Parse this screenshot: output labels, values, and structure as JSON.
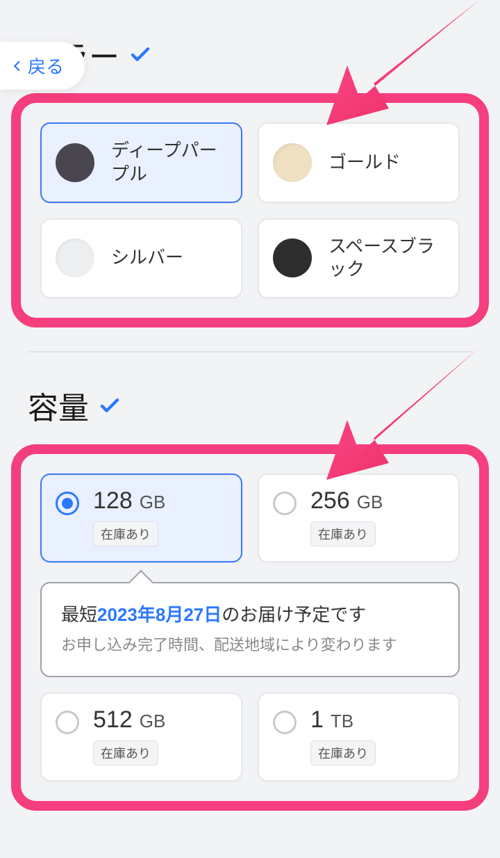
{
  "back": {
    "label": "戻る"
  },
  "colorSection": {
    "title": "カラー",
    "options": [
      {
        "label": "ディープパープル",
        "swatch": "#4a4650",
        "selected": true
      },
      {
        "label": "ゴールド",
        "swatch": "#eee0c1",
        "selected": false
      },
      {
        "label": "シルバー",
        "swatch": "#eceef0",
        "selected": false
      },
      {
        "label": "スペースブラック",
        "swatch": "#2d2d2d",
        "selected": false
      }
    ]
  },
  "capacitySection": {
    "title": "容量",
    "options": [
      {
        "num": "128",
        "unit": "GB",
        "stock": "在庫あり",
        "selected": true
      },
      {
        "num": "256",
        "unit": "GB",
        "stock": "在庫あり",
        "selected": false
      },
      {
        "num": "512",
        "unit": "GB",
        "stock": "在庫あり",
        "selected": false
      },
      {
        "num": "1",
        "unit": "TB",
        "stock": "在庫あり",
        "selected": false
      }
    ],
    "delivery": {
      "pre": "最短",
      "date": "2023年8月27日",
      "post": "のお届け予定です",
      "note": "お申し込み完了時間、配送地域により変わります"
    }
  },
  "accent": {
    "highlight": "#f43e7d",
    "blue": "#2b78ff"
  }
}
